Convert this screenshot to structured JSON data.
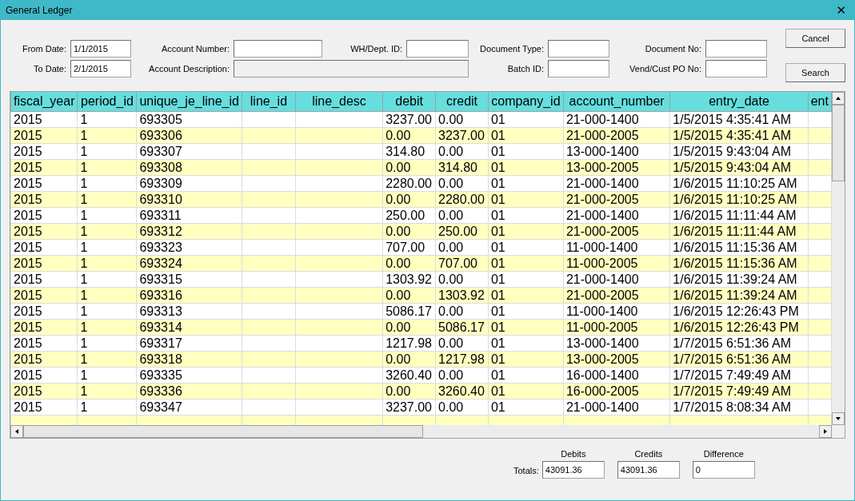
{
  "window": {
    "title": "General Ledger",
    "close": "✕"
  },
  "filters": [
    {
      "label": "From Date:",
      "value": "1/1/2015"
    },
    {
      "label": "Account Number:"
    },
    {
      "label": "WH/Dept. ID:"
    },
    {
      "label": "Document Type:"
    },
    {
      "label": "Document No:"
    },
    {
      "label": "To Date:",
      "value": "2/1/2015"
    },
    {
      "label": "Account Description:",
      "disabled": true
    },
    {
      "label": "Batch ID:"
    },
    {
      "label": "Vend/Cust PO No:"
    }
  ],
  "buttons": [
    "Cancel",
    "Search"
  ],
  "table": {
    "columns": [
      "fiscal_year",
      "period_id",
      "unique_je_line_id",
      "line_id",
      "line_desc",
      "debit",
      "credit",
      "company_id",
      "account_number",
      "entry_date",
      "ent"
    ],
    "rows": [
      [
        "2015",
        "1",
        "693305",
        "",
        "",
        "3237.00",
        "0.00",
        "01",
        "21-000-1400",
        "1/5/2015 4:35:41 AM"
      ],
      [
        "2015",
        "1",
        "693306",
        "",
        "",
        "0.00",
        "3237.00",
        "01",
        "21-000-2005",
        "1/5/2015 4:35:41 AM"
      ],
      [
        "2015",
        "1",
        "693307",
        "",
        "",
        "314.80",
        "0.00",
        "01",
        "13-000-1400",
        "1/5/2015 9:43:04 AM"
      ],
      [
        "2015",
        "1",
        "693308",
        "",
        "",
        "0.00",
        "314.80",
        "01",
        "13-000-2005",
        "1/5/2015 9:43:04 AM"
      ],
      [
        "2015",
        "1",
        "693309",
        "",
        "",
        "2280.00",
        "0.00",
        "01",
        "21-000-1400",
        "1/6/2015 11:10:25 AM"
      ],
      [
        "2015",
        "1",
        "693310",
        "",
        "",
        "0.00",
        "2280.00",
        "01",
        "21-000-2005",
        "1/6/2015 11:10:25 AM"
      ],
      [
        "2015",
        "1",
        "693311",
        "",
        "",
        "250.00",
        "0.00",
        "01",
        "21-000-1400",
        "1/6/2015 11:11:44 AM"
      ],
      [
        "2015",
        "1",
        "693312",
        "",
        "",
        "0.00",
        "250.00",
        "01",
        "21-000-2005",
        "1/6/2015 11:11:44 AM"
      ],
      [
        "2015",
        "1",
        "693323",
        "",
        "",
        "707.00",
        "0.00",
        "01",
        "11-000-1400",
        "1/6/2015 11:15:36 AM"
      ],
      [
        "2015",
        "1",
        "693324",
        "",
        "",
        "0.00",
        "707.00",
        "01",
        "11-000-2005",
        "1/6/2015 11:15:36 AM"
      ],
      [
        "2015",
        "1",
        "693315",
        "",
        "",
        "1303.92",
        "0.00",
        "01",
        "21-000-1400",
        "1/6/2015 11:39:24 AM"
      ],
      [
        "2015",
        "1",
        "693316",
        "",
        "",
        "0.00",
        "1303.92",
        "01",
        "21-000-2005",
        "1/6/2015 11:39:24 AM"
      ],
      [
        "2015",
        "1",
        "693313",
        "",
        "",
        "5086.17",
        "0.00",
        "01",
        "11-000-1400",
        "1/6/2015 12:26:43 PM"
      ],
      [
        "2015",
        "1",
        "693314",
        "",
        "",
        "0.00",
        "5086.17",
        "01",
        "11-000-2005",
        "1/6/2015 12:26:43 PM"
      ],
      [
        "2015",
        "1",
        "693317",
        "",
        "",
        "1217.98",
        "0.00",
        "01",
        "13-000-1400",
        "1/7/2015 6:51:36 AM"
      ],
      [
        "2015",
        "1",
        "693318",
        "",
        "",
        "0.00",
        "1217.98",
        "01",
        "13-000-2005",
        "1/7/2015 6:51:36 AM"
      ],
      [
        "2015",
        "1",
        "693335",
        "",
        "",
        "3260.40",
        "0.00",
        "01",
        "16-000-1400",
        "1/7/2015 7:49:49 AM"
      ],
      [
        "2015",
        "1",
        "693336",
        "",
        "",
        "0.00",
        "3260.40",
        "01",
        "16-000-2005",
        "1/7/2015 7:49:49 AM"
      ],
      [
        "2015",
        "1",
        "693347",
        "",
        "",
        "3237.00",
        "0.00",
        "01",
        "21-000-1400",
        "1/7/2015 8:08:34 AM"
      ]
    ]
  },
  "totals": {
    "label": "Totals:",
    "fields": [
      {
        "label": "Debits",
        "value": "43091.36"
      },
      {
        "label": "Credits",
        "value": "43091.36"
      },
      {
        "label": "Difference",
        "value": "0"
      }
    ]
  }
}
